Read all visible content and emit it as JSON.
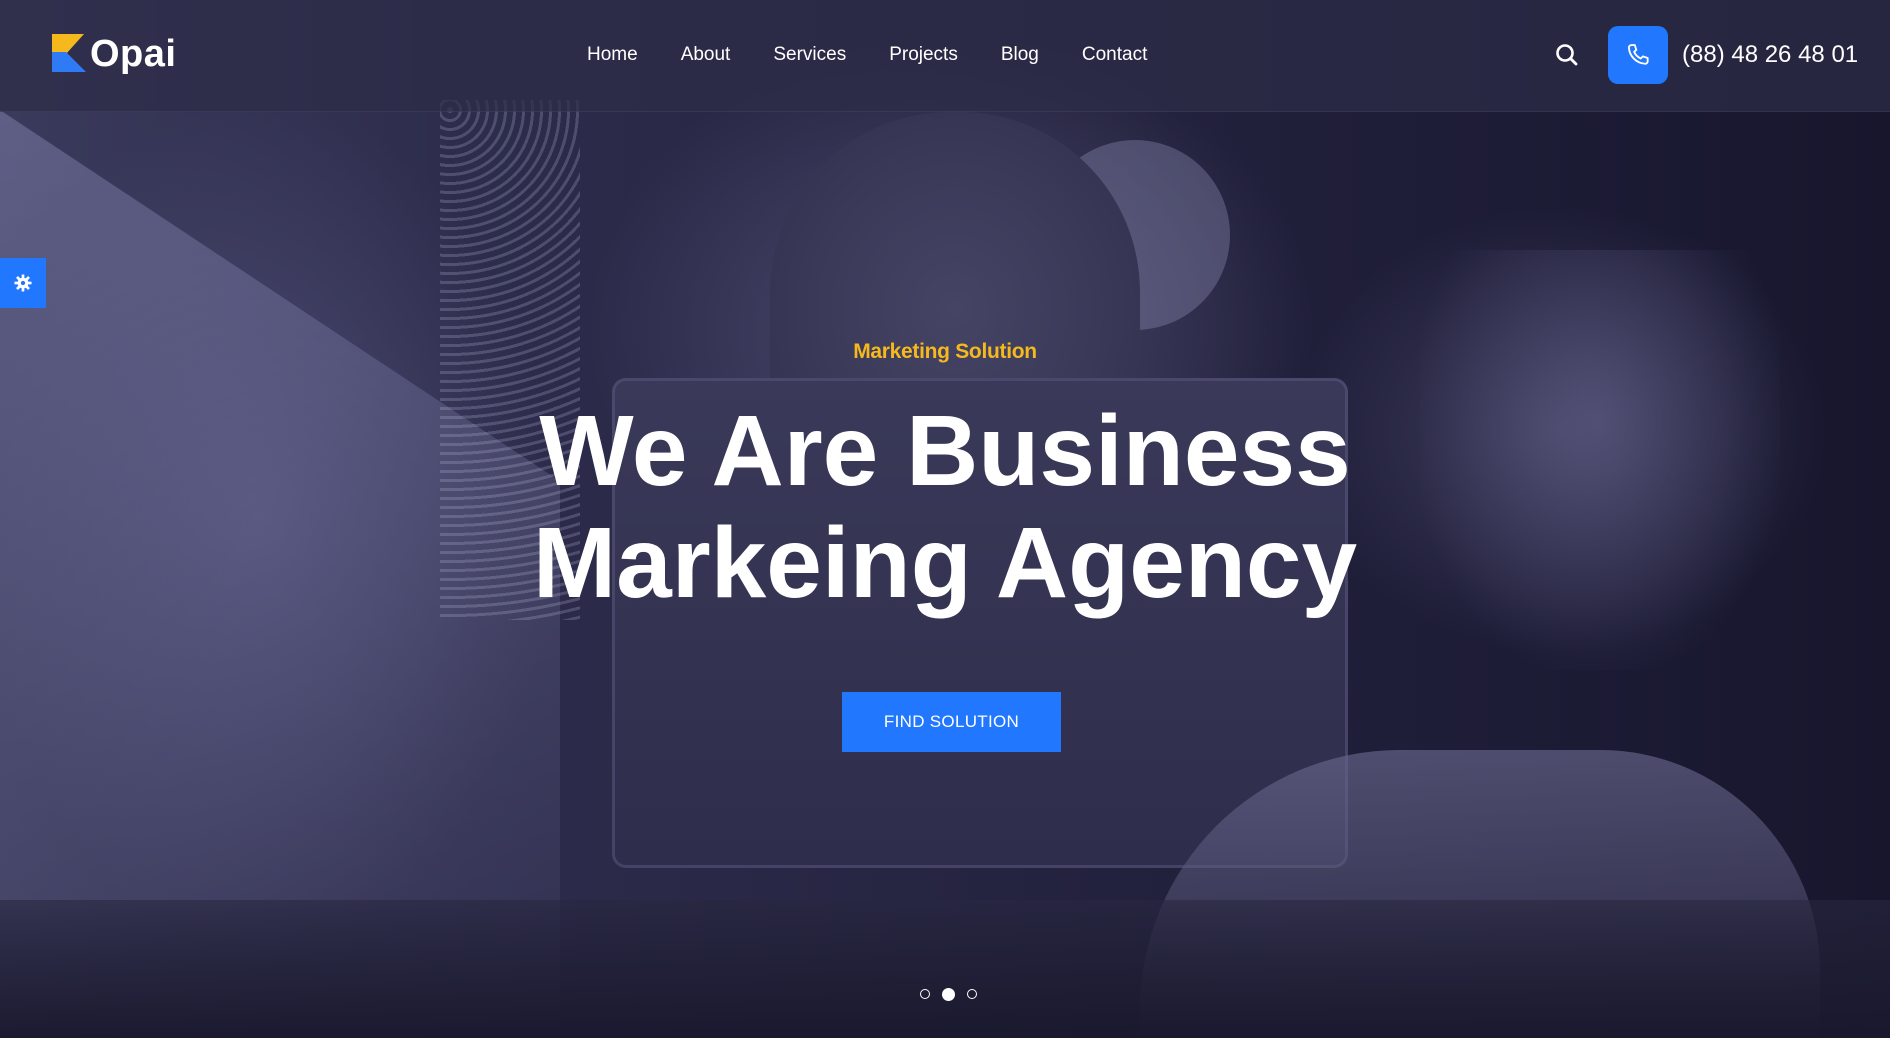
{
  "brand": {
    "name": "Opai",
    "colors": {
      "accent": "#2277ff",
      "highlight": "#f5b91e",
      "overlay": "#2c2c48"
    }
  },
  "nav": {
    "items": [
      {
        "label": "Home"
      },
      {
        "label": "About"
      },
      {
        "label": "Services"
      },
      {
        "label": "Projects"
      },
      {
        "label": "Blog"
      },
      {
        "label": "Contact"
      }
    ]
  },
  "header": {
    "search_icon": "search-icon",
    "phone_icon": "phone-icon",
    "phone_number": "(88) 48 26 48 01"
  },
  "settings": {
    "icon": "gear-icon"
  },
  "hero": {
    "eyebrow": "Marketing Solution",
    "headline_line1": "We Are Business",
    "headline_line2": "Markeing Agency",
    "cta_label": "FIND SOLUTION"
  },
  "slider": {
    "slide_count": 3,
    "active_slide": 2
  }
}
